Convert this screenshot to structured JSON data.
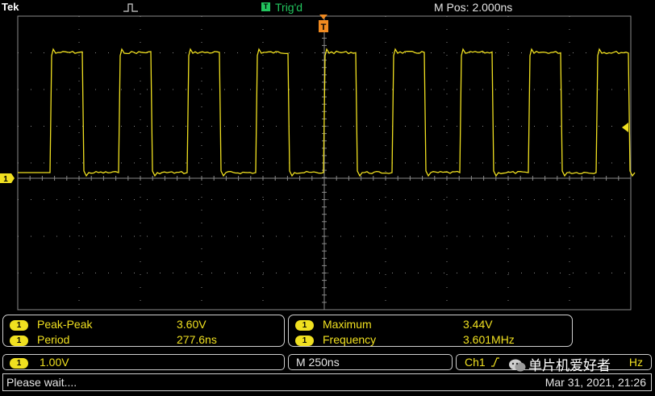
{
  "header": {
    "brand": "Tek",
    "trigger_status": "Trig'd",
    "trigger_icon_letter": "T",
    "position": "M Pos: 2.000ns"
  },
  "markers": {
    "trigger_marker_letter": "T",
    "channel_marker": "1"
  },
  "colors": {
    "trace": "#f0e020",
    "grid": "#8a8a8a",
    "trig_status": "#22c55e",
    "trigger_marker": "#f08a20"
  },
  "measurements_left": [
    {
      "channel": "1",
      "label": "Peak-Peak",
      "value": "3.60V"
    },
    {
      "channel": "1",
      "label": "Period",
      "value": "277.6ns"
    }
  ],
  "measurements_right": [
    {
      "channel": "1",
      "label": "Maximum",
      "value": "3.44V"
    },
    {
      "channel": "1",
      "label": "Frequency",
      "value": "3.601MHz"
    }
  ],
  "status_bar": {
    "channel": "1",
    "volts_per_div": "1.00V",
    "timebase": "M 250ns",
    "trigger_source": "Ch1",
    "trigger_tail": "Hz"
  },
  "watermark": "单片机爱好者",
  "footer": {
    "message": "Please wait....",
    "datetime": "Mar 31, 2021, 21:26"
  }
}
